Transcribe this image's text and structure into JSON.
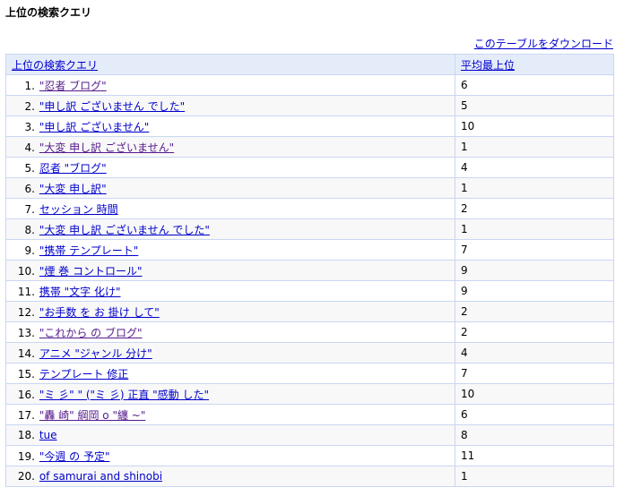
{
  "title": "上位の検索クエリ",
  "download_link": "このテーブルをダウンロード",
  "table": {
    "headers": {
      "query": "上位の検索クエリ",
      "rank": "平均最上位"
    },
    "rows": [
      {
        "num": "1.",
        "query": "\"忍者 ブログ\"",
        "rank": "6",
        "visited": true
      },
      {
        "num": "2.",
        "query": "\"申し訳 ございません でした\"",
        "rank": "5",
        "visited": false
      },
      {
        "num": "3.",
        "query": "\"申し訳 ございません\"",
        "rank": "10",
        "visited": false
      },
      {
        "num": "4.",
        "query": "\"大変 申し訳 ございません\"",
        "rank": "1",
        "visited": true
      },
      {
        "num": "5.",
        "query": "忍者 \"ブログ\"",
        "rank": "4",
        "visited": false
      },
      {
        "num": "6.",
        "query": "\"大変 申し訳\"",
        "rank": "1",
        "visited": false
      },
      {
        "num": "7.",
        "query": "セッション 時間",
        "rank": "2",
        "visited": false
      },
      {
        "num": "8.",
        "query": "\"大変 申し訳 ございません でした\"",
        "rank": "1",
        "visited": false
      },
      {
        "num": "9.",
        "query": "\"携帯 テンプレート\"",
        "rank": "7",
        "visited": false
      },
      {
        "num": "10.",
        "query": "\"煙 巻 コントロール\"",
        "rank": "9",
        "visited": false
      },
      {
        "num": "11.",
        "query": "携帯 \"文字 化け\"",
        "rank": "9",
        "visited": false
      },
      {
        "num": "12.",
        "query": "\"お手数 を お 掛け して\"",
        "rank": "2",
        "visited": false
      },
      {
        "num": "13.",
        "query": "\"これから の ブログ\"",
        "rank": "2",
        "visited": true
      },
      {
        "num": "14.",
        "query": "アニメ \"ジャンル 分け\"",
        "rank": "4",
        "visited": false
      },
      {
        "num": "15.",
        "query": "テンプレート 修正",
        "rank": "7",
        "visited": false
      },
      {
        "num": "16.",
        "query": "\"ミ 彡\" \" (\"ミ 彡) 正直 \"感動 した\"",
        "rank": "10",
        "visited": false
      },
      {
        "num": "17.",
        "query": "\"轟 崎\" 綱岡 o \"纏 ~\"",
        "rank": "6",
        "visited": true
      },
      {
        "num": "18.",
        "query": "tue",
        "rank": "8",
        "visited": false
      },
      {
        "num": "19.",
        "query": "\"今週 の 予定\"",
        "rank": "11",
        "visited": false
      },
      {
        "num": "20.",
        "query": "of samurai and shinobi",
        "rank": "1",
        "visited": false
      }
    ]
  }
}
